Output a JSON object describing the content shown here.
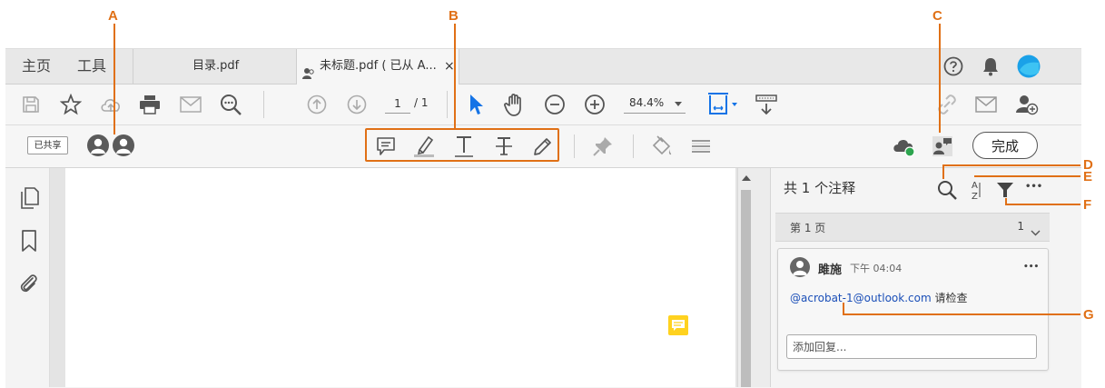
{
  "callouts": {
    "a": "A",
    "b": "B",
    "c": "C",
    "d": "D",
    "e": "E",
    "f": "F",
    "g": "G"
  },
  "tabs": {
    "home": "主页",
    "tools": "工具",
    "doc1": "目录.pdf",
    "doc2": "未标题.pdf ( 已从 A...",
    "close": "×"
  },
  "toolbar": {
    "page_current": "1",
    "page_total": "/ 1",
    "zoom": "84.4%"
  },
  "review_bar": {
    "shared_badge": "已共享",
    "done_label": "完成"
  },
  "comment_panel": {
    "title": "共 1 个注释",
    "more": "•••",
    "page_group_label": "第 1 页",
    "page_group_count": "1",
    "comment": {
      "author": "雎施",
      "time": "下午 04:04",
      "more": "•••",
      "mention": "@acrobat-1@outlook.com",
      "text": " 请检查"
    },
    "reply_placeholder": "添加回复..."
  },
  "colors": {
    "accent_orange": "#e07016",
    "select_blue": "#1473e6",
    "sticky_yellow": "#ffd21f",
    "cloud_green": "#2da44e",
    "avatar_blue": "#1aa1e8"
  },
  "icons": {
    "file_toolbar": [
      "save-icon",
      "star-icon",
      "cloud-upload-icon",
      "print-icon",
      "mail-icon",
      "search-zoom-icon",
      "arrow-up-icon",
      "arrow-down-icon",
      "cursor-icon",
      "hand-icon",
      "zoom-out-icon",
      "zoom-in-icon",
      "fit-page-icon",
      "scroll-mode-icon",
      "link-icon",
      "mail-icon",
      "add-user-icon"
    ],
    "review": [
      "comment-icon",
      "highlight-icon",
      "underline-icon",
      "strikethrough-icon",
      "pencil-icon",
      "pin-icon",
      "fill-icon",
      "lines-icon",
      "cloud-sync-icon",
      "share-review-icon"
    ]
  }
}
